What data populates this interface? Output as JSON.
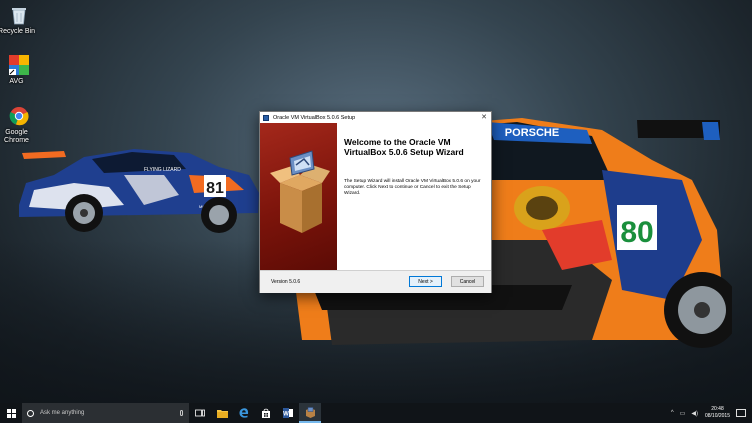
{
  "desktop": {
    "icons": [
      {
        "label": "Recycle Bin",
        "icon": "recycle-bin-icon"
      },
      {
        "label": "AVG",
        "icon": "avg-icon"
      },
      {
        "label": "Google Chrome",
        "icon": "chrome-icon"
      }
    ],
    "wallpaper": {
      "left_car_number": "81",
      "left_car_text": "FLYING LIZARD",
      "left_car_sponsor": "MICHELIN",
      "right_car_number": "80",
      "right_car_text": "PORSCHE"
    }
  },
  "dialog": {
    "title": "Oracle VM VirtualBox 5.0.6 Setup",
    "close_label": "✕",
    "heading": "Welcome to the Oracle VM VirtualBox 5.0.6 Setup Wizard",
    "body": "The Setup Wizard will install Oracle VM VirtualBox 5.0.6 on your computer. Click Next to continue or Cancel to exit the Setup Wizard.",
    "version": "Version 5.0.6",
    "next_label": "Next >",
    "cancel_label": "Cancel",
    "banner_icon": "virtualbox-box-icon"
  },
  "taskbar": {
    "search_placeholder": "Ask me anything",
    "apps": [
      "task-view-icon",
      "file-explorer-icon",
      "edge-icon",
      "store-icon",
      "word-icon",
      "virtualbox-icon"
    ],
    "time": "20:48",
    "date": "08/10/2015",
    "tray_symbols": [
      "^",
      "▭",
      "◀)"
    ]
  },
  "colors": {
    "taskbar": "#101418",
    "banner": "#8a1a0f",
    "accent": "#0078d7"
  }
}
